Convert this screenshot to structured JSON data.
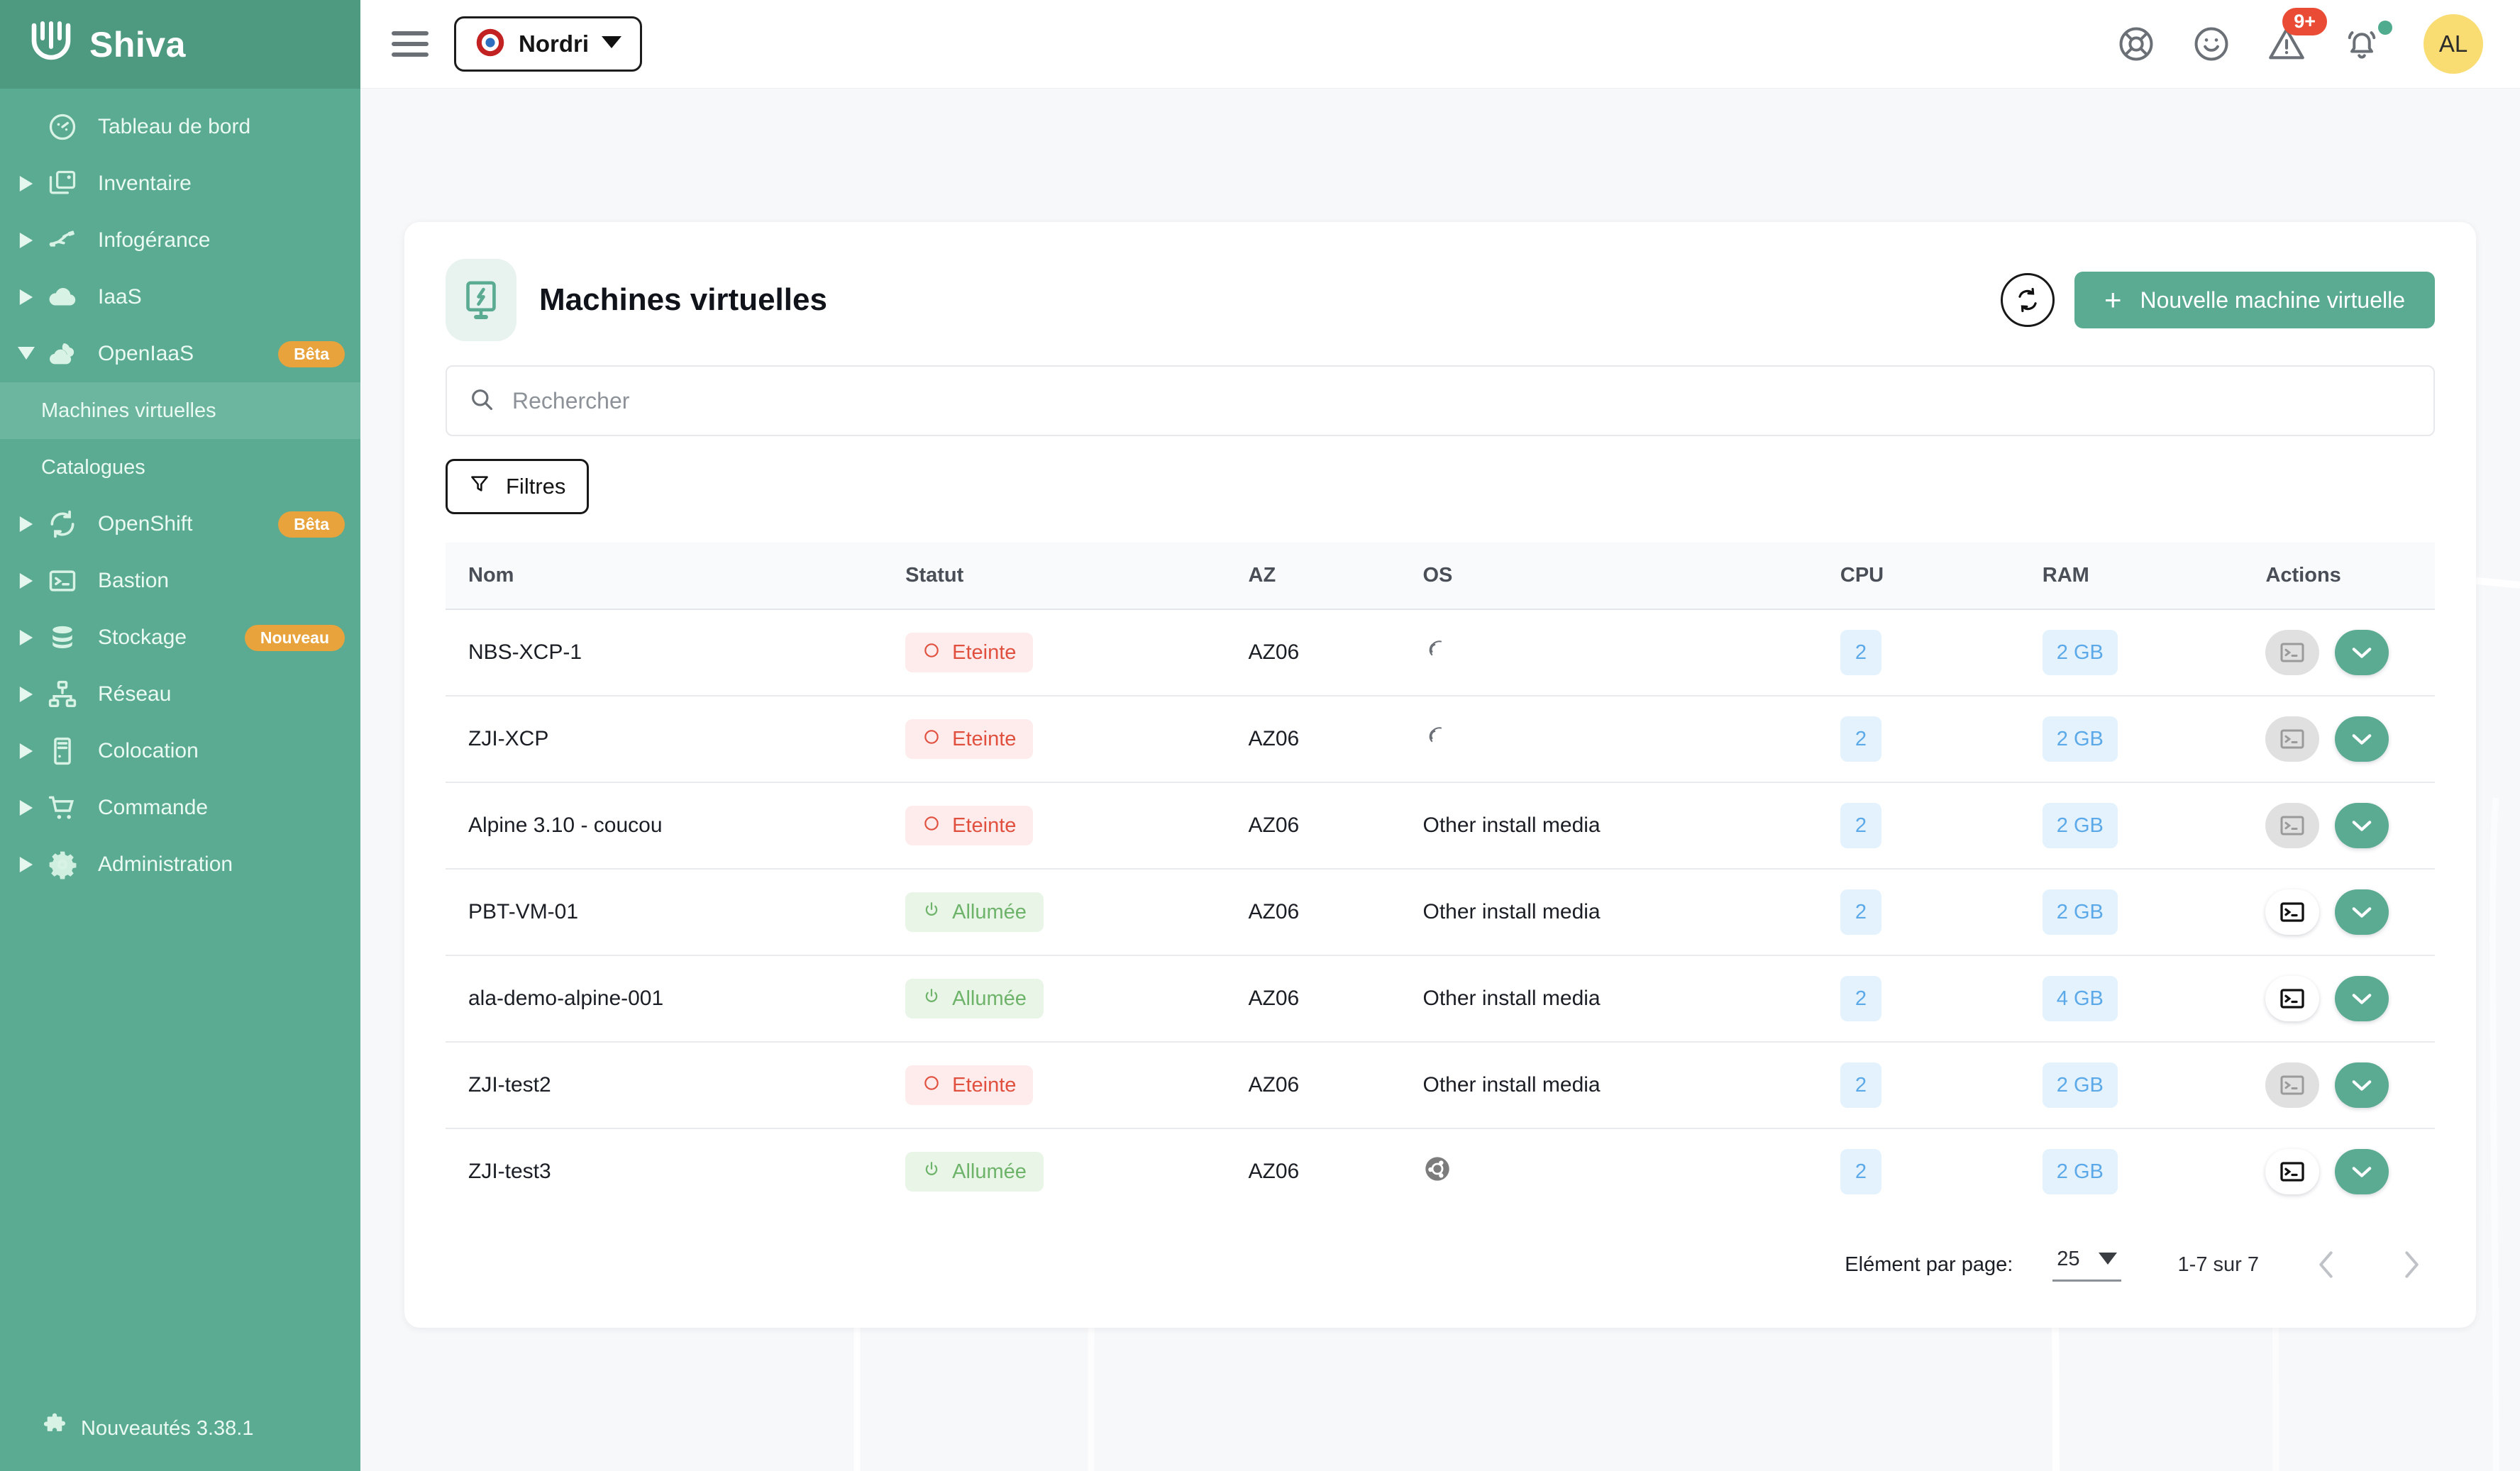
{
  "brand": {
    "name": "Shiva",
    "logo_icon": "shiva-logo-icon"
  },
  "sidebar": {
    "items": [
      {
        "label": "Tableau de bord",
        "icon": "dashboard-gauge-icon",
        "expandable": false,
        "badge": ""
      },
      {
        "label": "Inventaire",
        "icon": "inventory-icon",
        "expandable": true,
        "badge": ""
      },
      {
        "label": "Infogérance",
        "icon": "managed-services-icon",
        "expandable": true,
        "badge": ""
      },
      {
        "label": "IaaS",
        "icon": "cloud-icon",
        "expandable": true,
        "badge": ""
      },
      {
        "label": "OpenIaaS",
        "icon": "open-cloud-icon",
        "expandable": true,
        "expanded": true,
        "badge": "Bêta"
      }
    ],
    "sub_items": [
      {
        "label": "Machines virtuelles",
        "active": true
      },
      {
        "label": "Catalogues",
        "active": false
      }
    ],
    "items_after": [
      {
        "label": "OpenShift",
        "icon": "openshift-icon",
        "expandable": true,
        "badge": "Bêta"
      },
      {
        "label": "Bastion",
        "icon": "terminal-icon",
        "expandable": true,
        "badge": ""
      },
      {
        "label": "Stockage",
        "icon": "database-icon",
        "expandable": true,
        "badge": "Nouveau"
      },
      {
        "label": "Réseau",
        "icon": "network-icon",
        "expandable": true,
        "badge": ""
      },
      {
        "label": "Colocation",
        "icon": "rack-icon",
        "expandable": true,
        "badge": ""
      },
      {
        "label": "Commande",
        "icon": "cart-icon",
        "expandable": true,
        "badge": ""
      },
      {
        "label": "Administration",
        "icon": "gear-icon",
        "expandable": true,
        "badge": ""
      }
    ],
    "footer": {
      "label": "Nouveautés 3.38.1",
      "icon": "puzzle-icon"
    }
  },
  "topbar": {
    "menu_icon": "hamburger-icon",
    "tenant": {
      "name": "Nordri",
      "icon": "french-cockade-icon"
    },
    "icons": [
      {
        "name": "lifebuoy-help-icon"
      },
      {
        "name": "smiley-feedback-icon"
      },
      {
        "name": "warning-triangle-icon",
        "badge": "9+"
      },
      {
        "name": "bell-notification-icon",
        "dot": true
      }
    ],
    "avatar": {
      "initials": "AL"
    }
  },
  "page": {
    "icon": "virtual-machine-icon",
    "title": "Machines virtuelles",
    "refresh_label": "refresh-icon",
    "new_vm_label": "Nouvelle machine virtuelle",
    "plus": "+"
  },
  "search": {
    "placeholder": "Rechercher",
    "value": "",
    "icon": "search-icon"
  },
  "filters": {
    "label": "Filtres",
    "icon": "filter-funnel-icon"
  },
  "table": {
    "columns": [
      "Nom",
      "Statut",
      "AZ",
      "OS",
      "CPU",
      "RAM",
      "Actions"
    ],
    "rows": [
      {
        "nom": "NBS-XCP-1",
        "statut": "Eteinte",
        "state": "off",
        "az": "AZ06",
        "os": "",
        "os_icon": "debian-icon",
        "cpu": "2",
        "ram": "2 GB",
        "console_enabled": false
      },
      {
        "nom": "ZJI-XCP",
        "statut": "Eteinte",
        "state": "off",
        "az": "AZ06",
        "os": "",
        "os_icon": "debian-icon",
        "cpu": "2",
        "ram": "2 GB",
        "console_enabled": false
      },
      {
        "nom": "Alpine 3.10 - coucou",
        "statut": "Eteinte",
        "state": "off",
        "az": "AZ06",
        "os": "Other install media",
        "os_icon": "",
        "cpu": "2",
        "ram": "2 GB",
        "console_enabled": false
      },
      {
        "nom": "PBT-VM-01",
        "statut": "Allumée",
        "state": "on",
        "az": "AZ06",
        "os": "Other install media",
        "os_icon": "",
        "cpu": "2",
        "ram": "2 GB",
        "console_enabled": true
      },
      {
        "nom": "ala-demo-alpine-001",
        "statut": "Allumée",
        "state": "on",
        "az": "AZ06",
        "os": "Other install media",
        "os_icon": "",
        "cpu": "2",
        "ram": "4 GB",
        "console_enabled": true
      },
      {
        "nom": "ZJI-test2",
        "statut": "Eteinte",
        "state": "off",
        "az": "AZ06",
        "os": "Other install media",
        "os_icon": "",
        "cpu": "2",
        "ram": "2 GB",
        "console_enabled": false
      },
      {
        "nom": "ZJI-test3",
        "statut": "Allumée",
        "state": "on",
        "az": "AZ06",
        "os": "",
        "os_icon": "ubuntu-icon",
        "cpu": "2",
        "ram": "2 GB",
        "console_enabled": true
      }
    ]
  },
  "pagination": {
    "items_per_page_label": "Elément par page:",
    "page_size": "25",
    "range": "1-7 sur 7",
    "prev_icon": "chevron-left-icon",
    "next_icon": "chevron-right-icon"
  },
  "colors": {
    "brand_green": "#5aab91",
    "brand_green_dark": "#4d9a81",
    "badge_orange": "#e8a33d",
    "status_off": "#e1503f",
    "status_on": "#6eb36a",
    "chip_blue": "#5ba9e8",
    "alert_red": "#ea4b35",
    "avatar_yellow": "#f9dd73"
  }
}
